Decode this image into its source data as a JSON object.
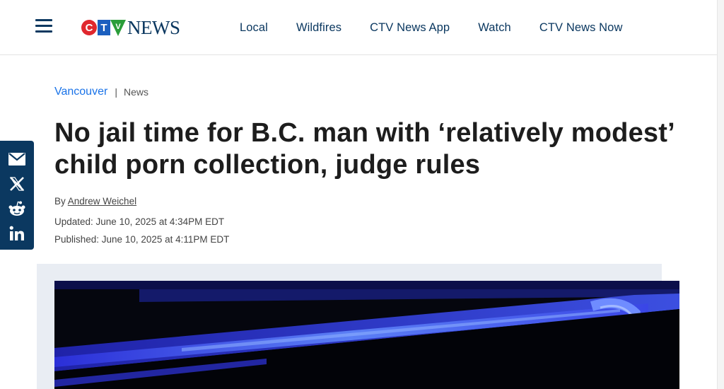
{
  "header": {
    "brand_word": "NEWS",
    "nav": [
      "Local",
      "Wildfires",
      "CTV News App",
      "Watch",
      "CTV News Now"
    ]
  },
  "article": {
    "breadcrumb": {
      "section": "Vancouver",
      "separator": "|",
      "category": "News"
    },
    "title": "No jail time for B.C. man with ‘relatively modest’ child porn collection, judge rules",
    "byline_prefix": "By",
    "author": "Andrew Weichel",
    "updated": "Updated: June 10, 2025 at 4:34PM EDT",
    "published": "Published: June 10, 2025 at 4:11PM EDT"
  },
  "share": {
    "icons": [
      "email-icon",
      "x-icon",
      "reddit-icon",
      "linkedin-icon"
    ]
  },
  "colors": {
    "brand_navy": "#0b3860",
    "link_blue": "#1a73e8",
    "logo_red": "#e0282e",
    "logo_blue": "#1b5fbf",
    "logo_green": "#2a9d3a"
  }
}
